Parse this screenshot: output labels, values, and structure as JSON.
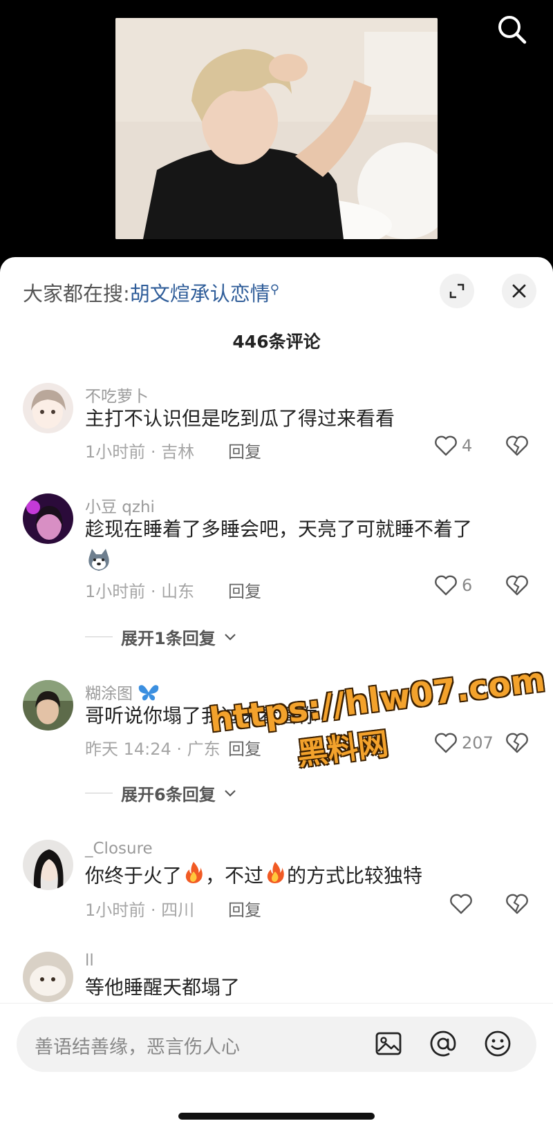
{
  "hot_search": {
    "prefix": "大家都在搜:",
    "term": "胡文煊承认恋情"
  },
  "comment_count": "446条评论",
  "comments": [
    {
      "username": "不吃萝卜",
      "text": "主打不认识但是吃到瓜了得过来看看",
      "time_location": "1小时前 · 吉林",
      "reply_label": "回复",
      "likes": "4"
    },
    {
      "username": "小豆 qzhi",
      "text": "趁现在睡着了多睡会吧，天亮了可就睡不着了",
      "time_location": "1小时前 · 山东",
      "reply_label": "回复",
      "likes": "6",
      "expand_replies": "展开1条回复"
    },
    {
      "username": "糊涂图",
      "text": "哥听说你塌了我过来看看你",
      "time_location": "昨天 14:24 · 广东",
      "reply_label": "回复",
      "likes": "207",
      "expand_replies": "展开6条回复"
    },
    {
      "username": "_Closure",
      "text_parts": [
        "你终于火了",
        "，不过",
        "的方式比较独特"
      ],
      "time_location": "1小时前 · 四川",
      "reply_label": "回复",
      "likes": ""
    },
    {
      "username": "ll",
      "text": "等他睡醒天都塌了"
    }
  ],
  "watermark": {
    "line1": "https://hlw07.com",
    "line2": "黑料网"
  },
  "input": {
    "placeholder": "善语结善缘，恶言伤人心"
  },
  "colors": {
    "link": "#2f5d99",
    "watermark": "#f3a22c"
  }
}
